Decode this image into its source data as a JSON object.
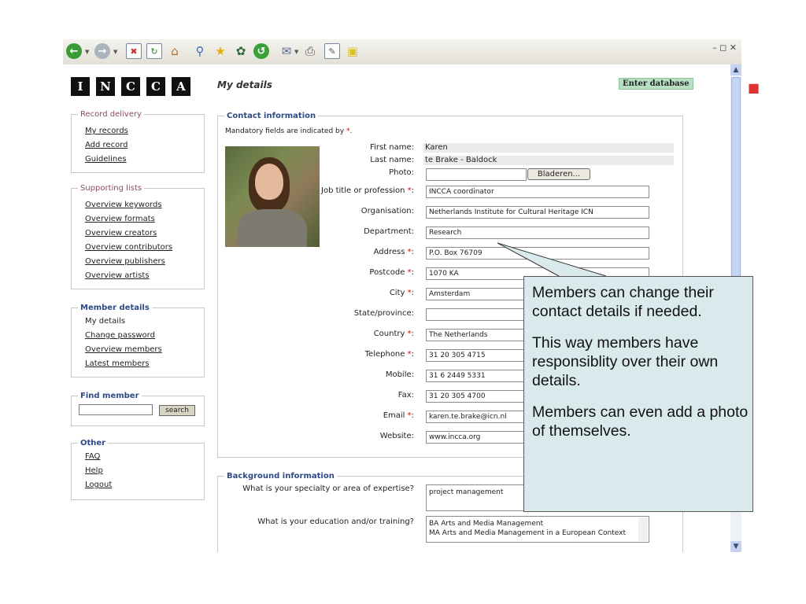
{
  "logo": [
    "I",
    "N",
    "C",
    "C",
    "A"
  ],
  "page_title": "My details",
  "enter_database": "Enter database",
  "sidebar": {
    "record_delivery": {
      "legend": "Record delivery",
      "links": [
        "My records",
        "Add record",
        "Guidelines"
      ]
    },
    "supporting_lists": {
      "legend": "Supporting lists",
      "links": [
        "Overview keywords",
        "Overview formats",
        "Overview creators",
        "Overview contributors",
        "Overview publishers",
        "Overview artists"
      ]
    },
    "member_details": {
      "legend": "Member details",
      "current": "My details",
      "links": [
        "Change password",
        "Overview members",
        "Latest members"
      ]
    },
    "find_member": {
      "legend": "Find member",
      "button": "search"
    },
    "other": {
      "legend": "Other",
      "links": [
        "FAQ",
        "Help",
        "Logout"
      ]
    }
  },
  "contact": {
    "legend": "Contact information",
    "mandatory_note": "Mandatory fields are indicated by ",
    "mandatory_marker": "*",
    "mandatory_end": ".",
    "first_name_label": "First name:",
    "first_name": "Karen",
    "last_name_label": "Last name:",
    "last_name": "te Brake - Baldock",
    "photo_label": "Photo:",
    "browse_button": "Bladeren...",
    "fields": [
      {
        "label": "Job title or profession",
        "required": true,
        "value": "INCCA coordinator"
      },
      {
        "label": "Organisation:",
        "required": false,
        "value": "Netherlands Institute for Cultural Heritage ICN"
      },
      {
        "label": "Department:",
        "required": false,
        "value": "Research"
      },
      {
        "label": "Address",
        "required": true,
        "value": "P.O. Box 76709"
      },
      {
        "label": "Postcode",
        "required": true,
        "value": "1070 KA"
      },
      {
        "label": "City",
        "required": true,
        "value": "Amsterdam"
      },
      {
        "label": "State/province:",
        "required": false,
        "value": ""
      },
      {
        "label": "Country",
        "required": true,
        "value": "The Netherlands"
      },
      {
        "label": "Telephone",
        "required": true,
        "value": "31 20 305 4715"
      },
      {
        "label": "Mobile:",
        "required": false,
        "value": "31 6 2449 5331"
      },
      {
        "label": "Fax:",
        "required": false,
        "value": "31 20 305 4700"
      },
      {
        "label": "Email",
        "required": true,
        "value": "karen.te.brake@icn.nl"
      },
      {
        "label": "Website:",
        "required": false,
        "value": "www.incca.org"
      }
    ]
  },
  "background": {
    "legend": "Background information",
    "q1": "What is your specialty or area of expertise?",
    "a1": "project management",
    "q2": "What is your education and/or training?",
    "a2_line1": "BA Arts and Media Management",
    "a2_line2": "MA Arts and Media Management in a European Context"
  },
  "callout": {
    "p1": "Members can change their contact details if needed.",
    "p2": "This way members have responsiblity over their own details.",
    "p3": "Members can even add a photo of themselves."
  },
  "colors": {
    "enter_db_bg": "#b7e0c3",
    "callout_bg": "#d9e9ec",
    "required_marker": "#dd0000",
    "legend_blue": "#2e4a86"
  }
}
